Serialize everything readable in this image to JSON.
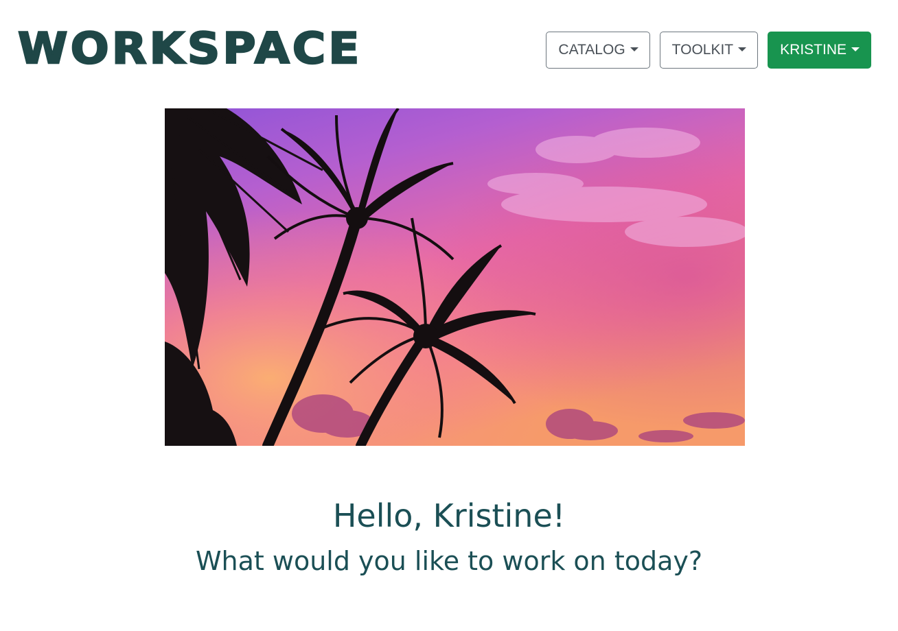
{
  "app": {
    "logo_text": "WORKSPACE"
  },
  "nav": {
    "items": [
      {
        "label": "CATALOG",
        "style": "outline"
      },
      {
        "label": "TOOLKIT",
        "style": "outline"
      },
      {
        "label": "KRISTINE",
        "style": "primary"
      }
    ]
  },
  "hero": {
    "image_subject": "palm trees silhouetted against a pink and purple sunset sky"
  },
  "welcome": {
    "greeting": "Hello, Kristine!",
    "prompt": "What would you like to work on today?"
  },
  "colors": {
    "brand_dark_teal": "#1f4747",
    "heading_teal": "#1b4f55",
    "primary_green": "#18944f",
    "outline_gray": "#6c757d"
  }
}
